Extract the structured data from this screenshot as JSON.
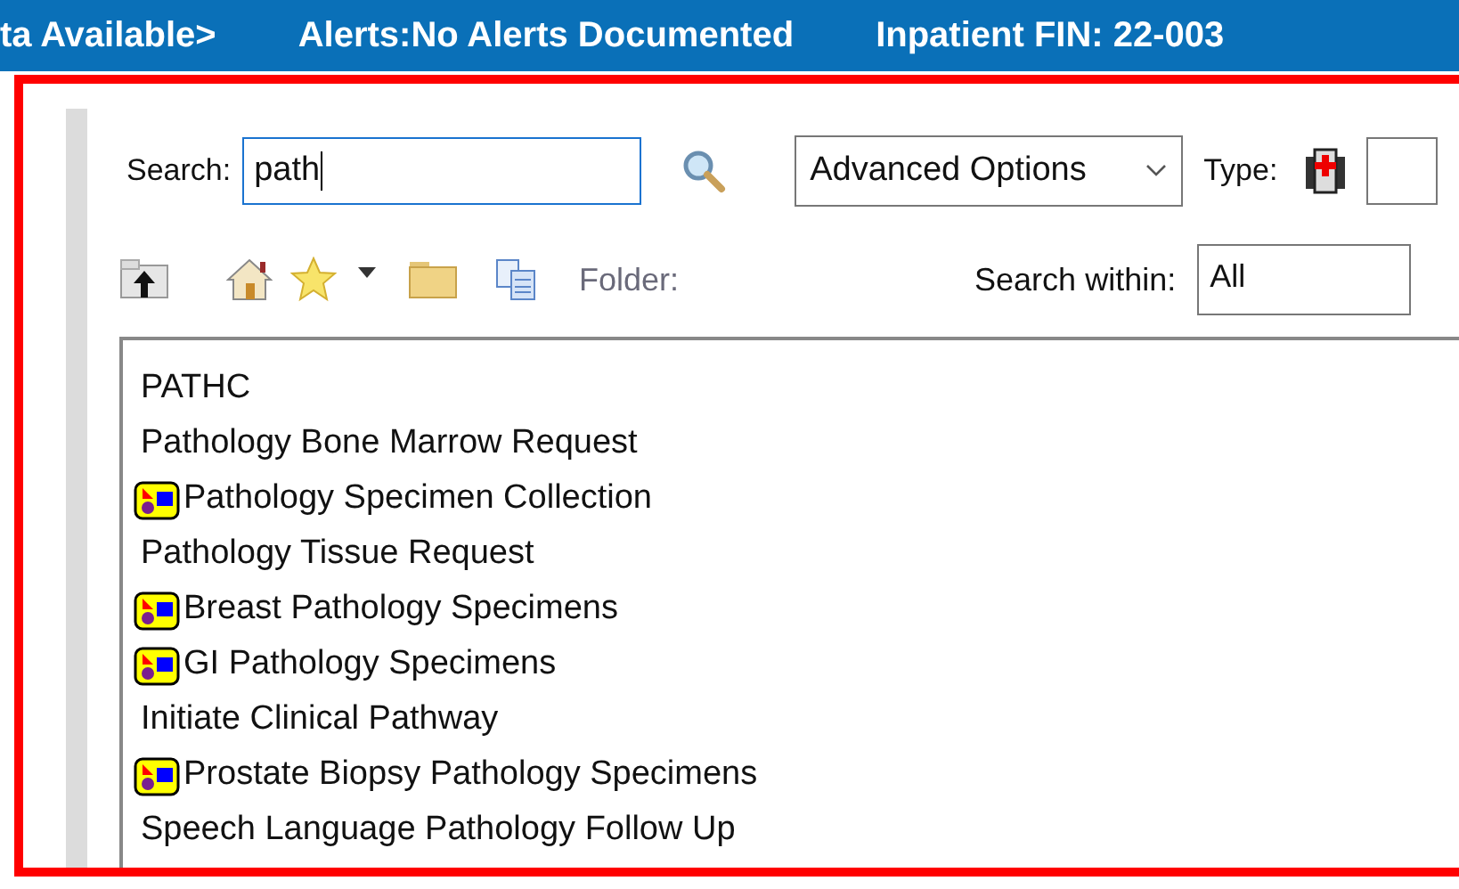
{
  "banner": {
    "items": [
      "ta Available>",
      "Alerts:No Alerts Documented",
      "Inpatient FIN: 22-003"
    ]
  },
  "search": {
    "label": "Search:",
    "value": "path"
  },
  "advanced_options": {
    "value": "Advanced Options"
  },
  "type": {
    "label": "Type:"
  },
  "toolbar": {
    "folder_label": "Folder:",
    "search_within_label": "Search within:",
    "search_within_value": "All"
  },
  "results": [
    {
      "kind": "order",
      "label": "PATHC"
    },
    {
      "kind": "order",
      "label": "Pathology Bone Marrow Request"
    },
    {
      "kind": "careset",
      "label": "Pathology Specimen Collection"
    },
    {
      "kind": "order",
      "label": "Pathology Tissue Request"
    },
    {
      "kind": "careset",
      "label": "Breast Pathology Specimens"
    },
    {
      "kind": "careset",
      "label": "GI Pathology Specimens"
    },
    {
      "kind": "order",
      "label": "Initiate Clinical Pathway"
    },
    {
      "kind": "careset",
      "label": "Prostate Biopsy Pathology Specimens"
    },
    {
      "kind": "order",
      "label": "Speech Language Pathology Follow Up"
    }
  ]
}
